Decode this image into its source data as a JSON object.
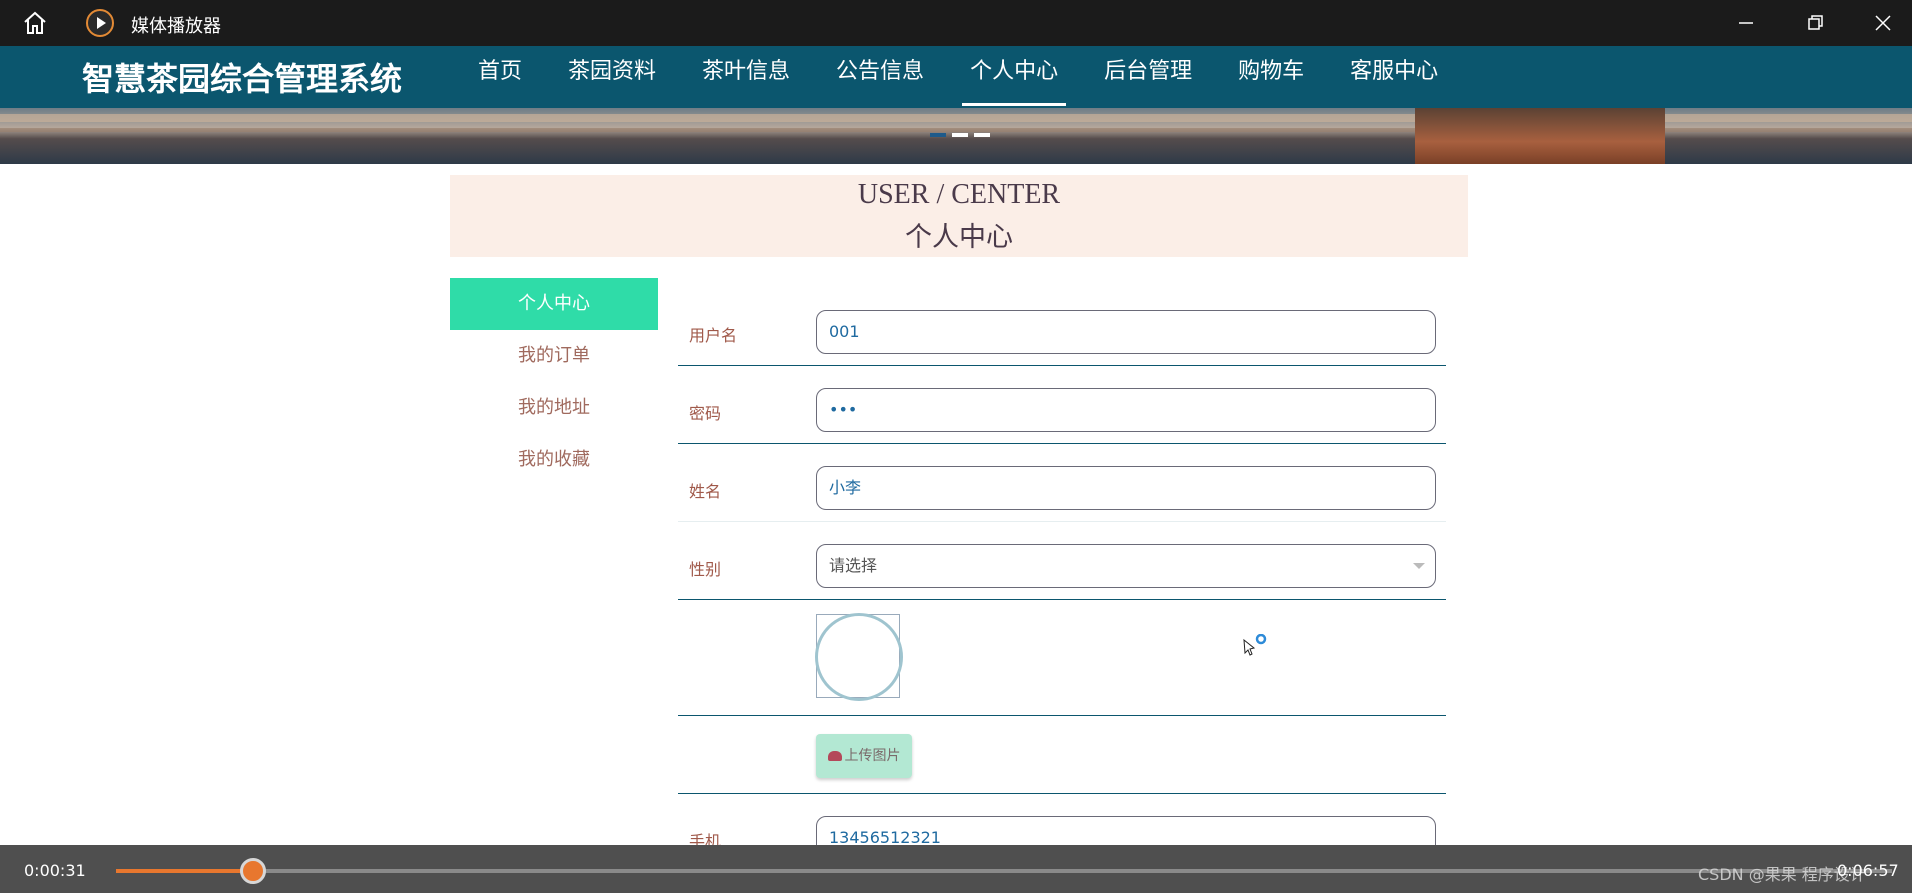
{
  "window": {
    "app_title": "媒体播放器",
    "icons": [
      "home-icon",
      "media-player-icon",
      "minimize-icon",
      "maximize-icon",
      "close-icon"
    ]
  },
  "nav": {
    "site_title": "智慧茶园综合管理系统",
    "items": [
      "首页",
      "茶园资料",
      "茶叶信息",
      "公告信息",
      "个人中心",
      "后台管理",
      "购物车",
      "客服中心"
    ],
    "active_index": 4
  },
  "banner": {
    "slides": 3,
    "active_slide": 1
  },
  "page_header": {
    "en": "USER / CENTER",
    "cn": "个人中心"
  },
  "sidebar": {
    "items": [
      "个人中心",
      "我的订单",
      "我的地址",
      "我的收藏"
    ],
    "active_index": 0
  },
  "form": {
    "username": {
      "label": "用户名",
      "value": "001"
    },
    "password": {
      "label": "密码",
      "value": "•••"
    },
    "name": {
      "label": "姓名",
      "value": "小李"
    },
    "gender": {
      "label": "性别",
      "placeholder": "请选择"
    },
    "upload_label": "上传图片",
    "phone": {
      "label": "手机",
      "value": "13456512321"
    }
  },
  "player": {
    "current_time": "0:00:31",
    "total_time": "0:06:57",
    "progress": 0.077,
    "watermark": "CSDN @果果 程序设计"
  },
  "colors": {
    "nav_bg": "#0b566e",
    "sidebar_active": "#2fdca8",
    "header_bg": "#fbeee7",
    "progress": "#e8772e"
  }
}
